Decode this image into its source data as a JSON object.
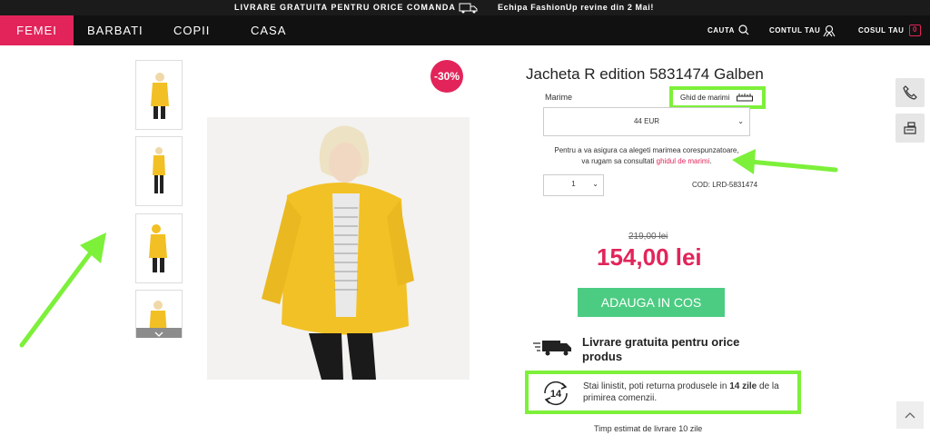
{
  "topbar": {
    "promo_shipping": "LIVRARE GRATUITA PENTRU ORICE COMANDA",
    "promo_team": "Echipa FashionUp revine din 2 Mai!"
  },
  "nav": {
    "items": [
      "FEMEI",
      "BARBATI",
      "COPII",
      "CASA"
    ],
    "search": "CAUTA",
    "account": "CONTUL TAU",
    "cart": "COSUL TAU",
    "cart_count": "0"
  },
  "product": {
    "discount": "-30%",
    "title": "Jacheta R edition 5831474 Galben",
    "size_label": "Marime",
    "size_guide": "Ghid de marimi",
    "size_value": "44 EUR",
    "notice_line1": "Pentru a va asigura ca alegeti marimea corespunzatoare,",
    "notice_line2": "va rugam sa consultati",
    "notice_link": "ghidul de marimi",
    "notice_end": ".",
    "quantity": "1",
    "code": "COD: LRD-5831474",
    "old_price": "219,00 lei",
    "new_price": "154,00 lei",
    "add_to_cart": "ADAUGA IN COS",
    "shipping": "Livrare gratuita pentru orice produs",
    "return_pre": "Stai linistit, poti returna produsele in",
    "return_bold": "14 zile",
    "return_post": "de la primirea comenzii.",
    "return_days_badge": "14",
    "estimate": "Timp estimat de livrare 10 zile"
  },
  "colors": {
    "accent": "#e2245a",
    "cart_button": "#4ccc82",
    "highlight": "#7df03a",
    "nav_bg": "#111111"
  }
}
